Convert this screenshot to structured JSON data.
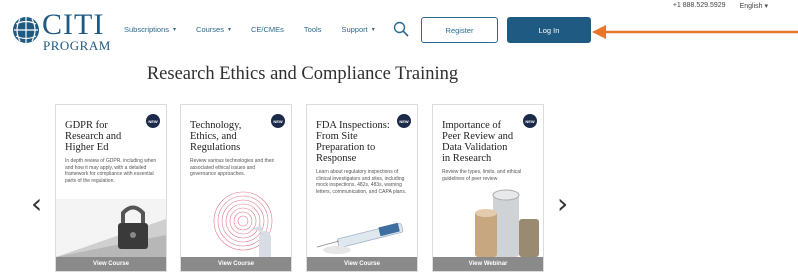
{
  "util": {
    "phone": "+1 888.529.5929",
    "language": "English"
  },
  "logo": {
    "word": "CITI",
    "sub": "PROGRAM"
  },
  "nav": [
    {
      "label": "Subscriptions",
      "dropdown": true
    },
    {
      "label": "Courses",
      "dropdown": true
    },
    {
      "label": "CE/CMEs",
      "dropdown": false
    },
    {
      "label": "Tools",
      "dropdown": false
    },
    {
      "label": "Support",
      "dropdown": true
    }
  ],
  "buttons": {
    "register": "Register",
    "login": "Log In"
  },
  "headline": "Research Ethics and Compliance Training",
  "cards": [
    {
      "badge": "NEW",
      "title": "GDPR for Research and Higher Ed",
      "desc": "In depth review of GDPR, including when and how it may apply, with a detailed framework for compliance with essential parts of the regulation.",
      "cta": "View Course"
    },
    {
      "badge": "NEW",
      "title": "Technology, Ethics, and Regulations",
      "desc": "Review various technologies and their associated ethical issues and governance approaches.",
      "cta": "View Course"
    },
    {
      "badge": "NEW",
      "title": "FDA Inspections: From Site Preparation to Response",
      "desc": "Learn about regulatory inspections of clinical investigators and sites, including mock inspections, 482s, 483s, warning letters, communication, and CAPA plans.",
      "cta": "View Course"
    },
    {
      "badge": "NEW",
      "title": "Importance of Peer Review and Data Validation in Research",
      "desc": "Review the types, limits, and ethical guidelines of peer review",
      "cta": "View Webinar"
    }
  ],
  "colors": {
    "brand": "#1f5a82",
    "arrow": "#e8772e",
    "badge": "#1b2a48",
    "cta": "#8a8a8a"
  }
}
